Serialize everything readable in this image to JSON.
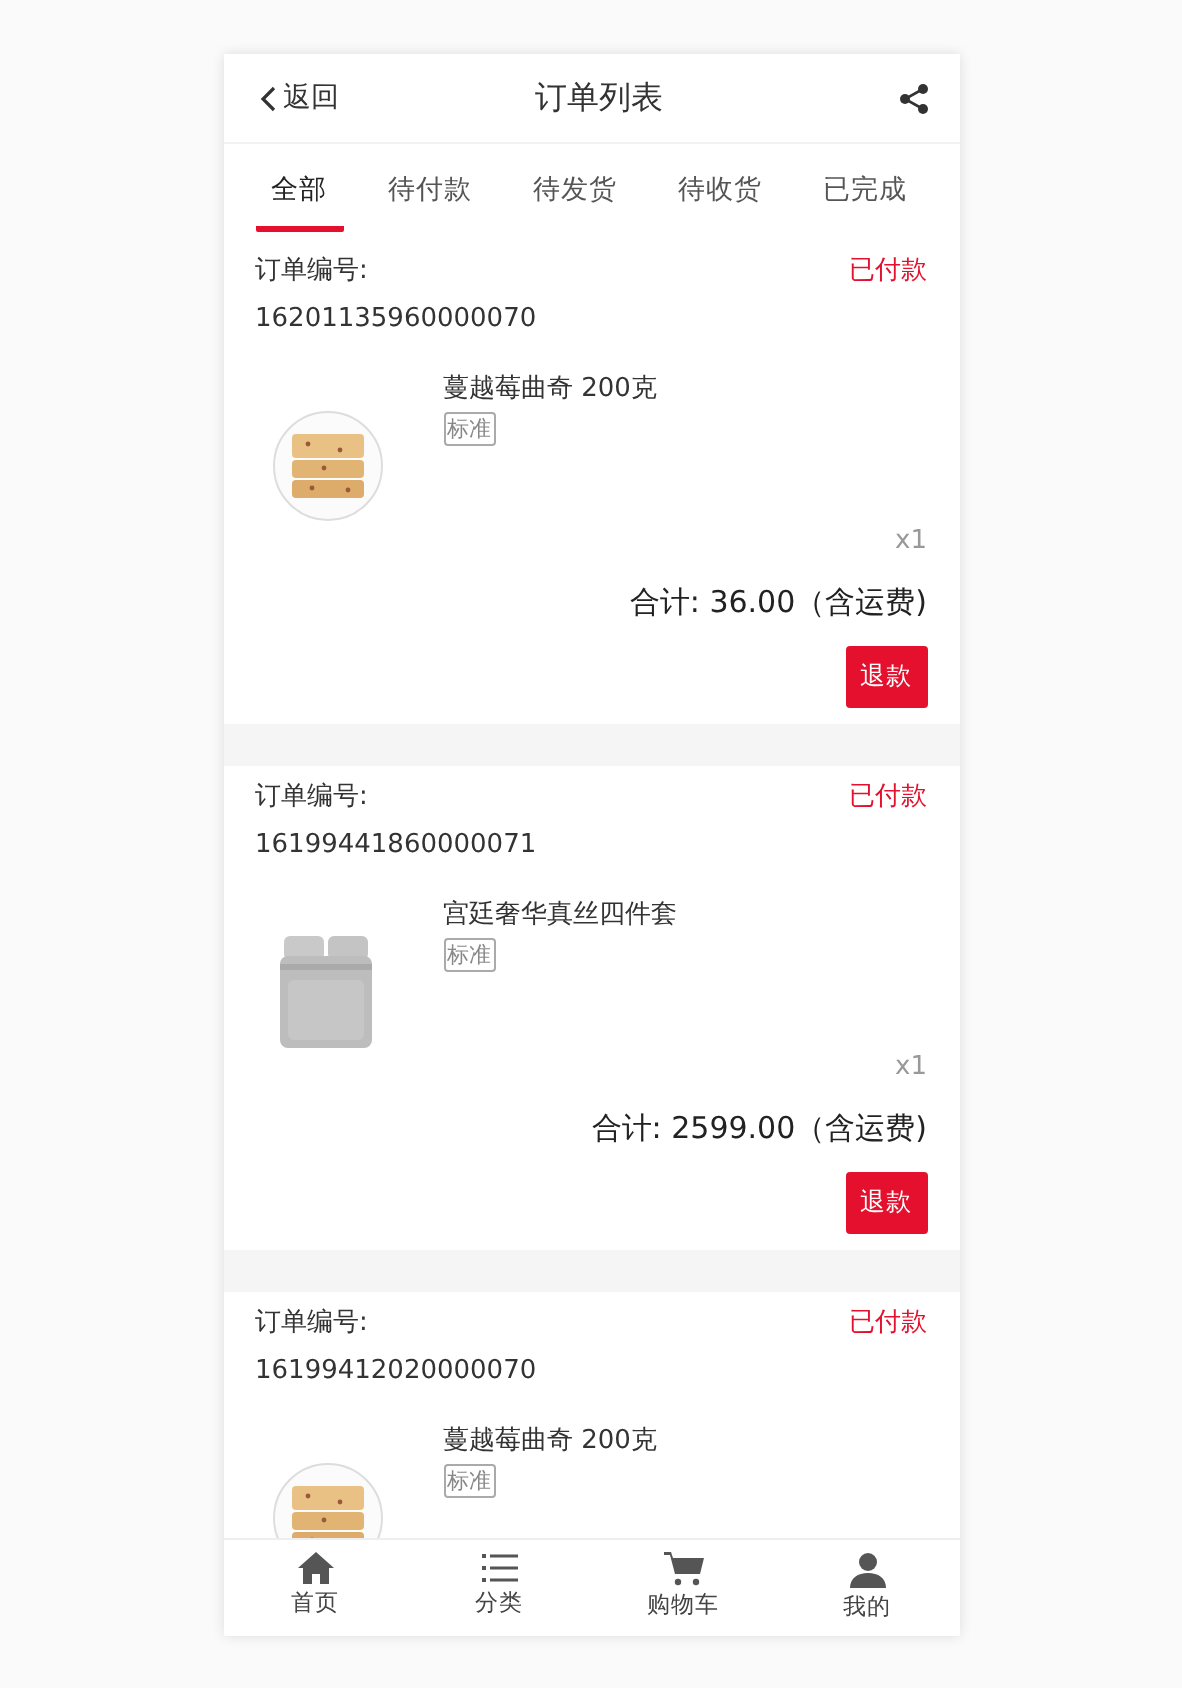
{
  "header": {
    "back_label": "返回",
    "title": "订单列表"
  },
  "tabs": [
    {
      "label": "全部",
      "selected": true
    },
    {
      "label": "待付款",
      "selected": false
    },
    {
      "label": "待发货",
      "selected": false
    },
    {
      "label": "待收货",
      "selected": false
    },
    {
      "label": "已完成",
      "selected": false
    }
  ],
  "orders": [
    {
      "number_label": "订单编号:",
      "number": "16201135960000070",
      "status": "已付款",
      "product": {
        "kind": "cookie",
        "name": "蔓越莓曲奇 200克",
        "spec": "标准",
        "quantity": "x1"
      },
      "total": "合计: 36.00（含运费)",
      "action": "退款"
    },
    {
      "number_label": "订单编号:",
      "number": "16199441860000071",
      "status": "已付款",
      "product": {
        "kind": "bedding",
        "name": "宫廷奢华真丝四件套",
        "spec": "标准",
        "quantity": "x1"
      },
      "total": "合计: 2599.00（含运费)",
      "action": "退款"
    },
    {
      "number_label": "订单编号:",
      "number": "16199412020000070",
      "status": "已付款",
      "product": {
        "kind": "cookie",
        "name": "蔓越莓曲奇 200克",
        "spec": "标准"
      }
    }
  ],
  "tab_bar": [
    {
      "kind": "home",
      "label": "首页",
      "selected": false
    },
    {
      "kind": "list",
      "label": "分类",
      "selected": false
    },
    {
      "kind": "cart",
      "label": "购物车",
      "selected": false
    },
    {
      "kind": "user",
      "label": "我的",
      "selected": false
    }
  ]
}
